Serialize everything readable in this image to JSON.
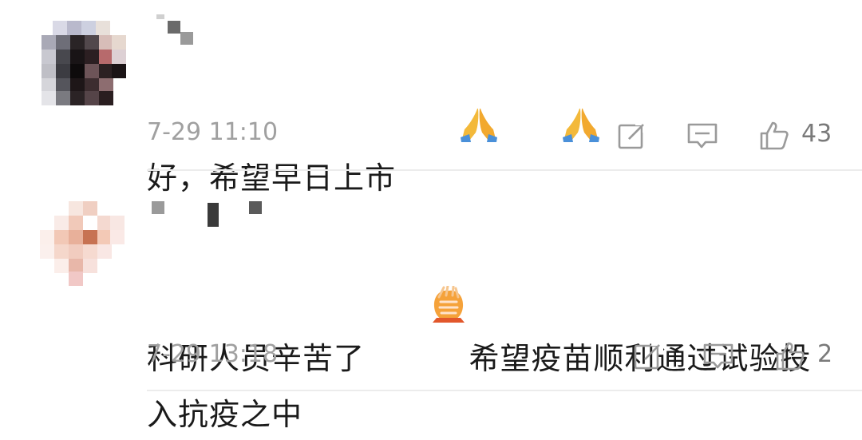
{
  "comments": [
    {
      "text": "好，希望早日上市",
      "emoji_after": "folded-hands-icon x2",
      "time": "7-29 11:10",
      "likes": "43"
    },
    {
      "text_before": "科研人员辛苦了",
      "emoji_mid": "clapping-hands-icon",
      "text_after": "希望疫苗顺利通过试验投入抗疫之中",
      "time": "7-29 13:18",
      "likes": "2"
    }
  ],
  "colors": {
    "text": "#1a1a1a",
    "meta": "#a0a0a0",
    "icon": "#9a9a9a",
    "divider": "#ececec"
  }
}
